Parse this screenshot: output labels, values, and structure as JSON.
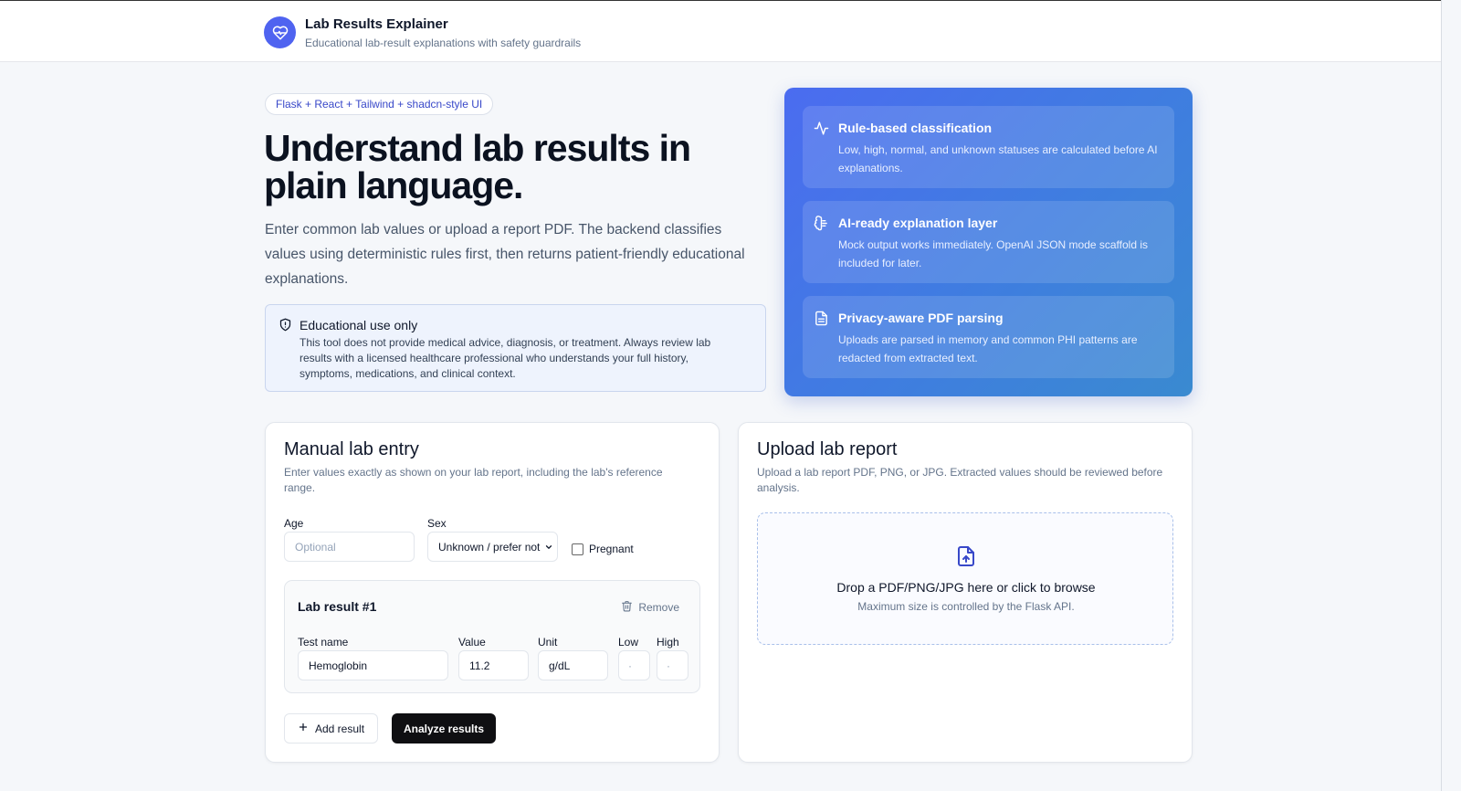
{
  "header": {
    "title": "Lab Results Explainer",
    "subtitle": "Educational lab-result explanations with safety guardrails",
    "logo_icon": "heart-pulse-icon"
  },
  "hero": {
    "pill": "Flask + React + Tailwind + shadcn-style UI",
    "title": "Understand lab results in plain language.",
    "description": "Enter common lab values or upload a report PDF. The backend classifies values using deterministic rules first, then returns patient-friendly educational explanations."
  },
  "disclaimer": {
    "title": "Educational use only",
    "text": "This tool does not provide medical advice, diagnosis, or treatment. Always review lab results with a licensed healthcare professional who understands your full history, symptoms, medications, and clinical context."
  },
  "features": [
    {
      "icon": "activity-icon",
      "title": "Rule-based classification",
      "text": "Low, high, normal, and unknown statuses are calculated before AI explanations."
    },
    {
      "icon": "brain-icon",
      "title": "AI-ready explanation layer",
      "text": "Mock output works immediately. OpenAI JSON mode scaffold is included for later."
    },
    {
      "icon": "file-text-icon",
      "title": "Privacy-aware PDF parsing",
      "text": "Uploads are parsed in memory and common PHI patterns are redacted from extracted text."
    }
  ],
  "manual": {
    "title": "Manual lab entry",
    "subtitle": "Enter values exactly as shown on your lab report, including the lab's reference range.",
    "age_label": "Age",
    "age_placeholder": "Optional",
    "sex_label": "Sex",
    "sex_value": "Unknown / prefer not",
    "pregnant_label": "Pregnant",
    "result": {
      "title": "Lab result #1",
      "remove_label": "Remove",
      "test_name_label": "Test name",
      "test_name_value": "Hemoglobin",
      "value_label": "Value",
      "value_value": "11.2",
      "unit_label": "Unit",
      "unit_value": "g/dL",
      "low_label": "Low",
      "low_value": "·",
      "high_label": "High",
      "high_value": "·"
    },
    "add_label": "Add result",
    "analyze_label": "Analyze results"
  },
  "upload": {
    "title": "Upload lab report",
    "subtitle": "Upload a lab report PDF, PNG, or JPG. Extracted values should be reviewed before analysis.",
    "drop_title": "Drop a PDF/PNG/JPG here or click to browse",
    "drop_sub": "Maximum size is controlled by the Flask API."
  },
  "colors": {
    "accent": "#4f63f0",
    "panel_gradient_start": "#4b6cf0",
    "panel_gradient_end": "#3a8ad0",
    "primary_button": "#0f0f12"
  }
}
